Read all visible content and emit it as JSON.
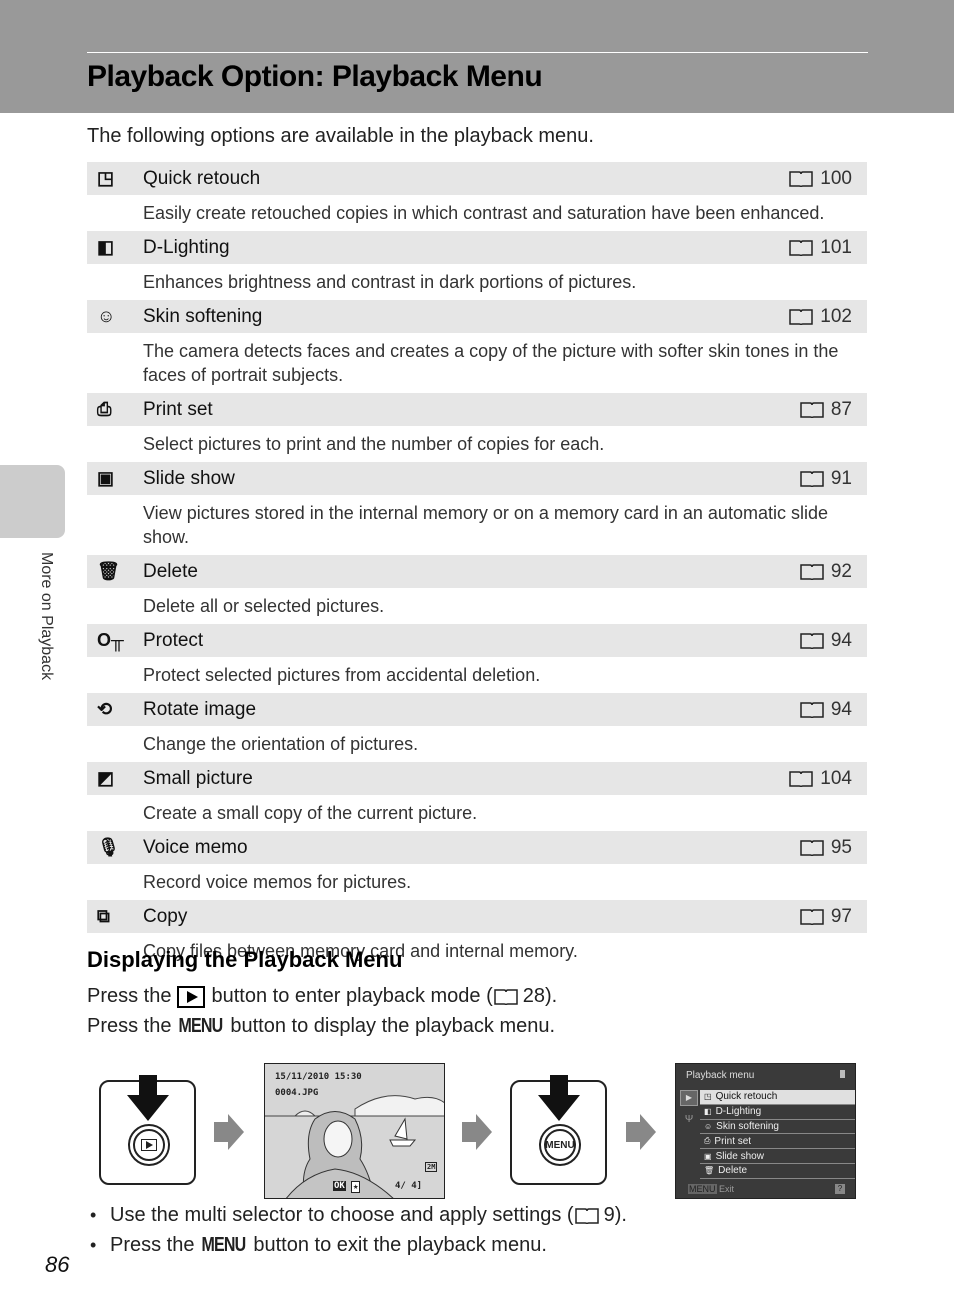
{
  "header": {
    "title": "Playback Option: Playback Menu"
  },
  "intro": "The following options are available in the playback menu.",
  "side_tab": {
    "label": "More on Playback"
  },
  "options": [
    {
      "icon": "quick-retouch",
      "glyph": "◳",
      "label": "Quick retouch",
      "ref": "100",
      "desc": "Easily create retouched copies in which contrast and saturation have been enhanced."
    },
    {
      "icon": "d-lighting",
      "glyph": "◧",
      "label": "D-Lighting",
      "ref": "101",
      "desc": "Enhances brightness and contrast in dark portions of pictures."
    },
    {
      "icon": "skin-softening",
      "glyph": "☺",
      "label": "Skin softening",
      "ref": "102",
      "desc": "The camera detects faces and creates a copy of the picture with softer skin tones in the faces of portrait subjects."
    },
    {
      "icon": "print-set",
      "glyph": "⎙",
      "label": "Print set",
      "ref": "87",
      "desc": "Select pictures to print and the number of copies for each."
    },
    {
      "icon": "slide-show",
      "glyph": "▣",
      "label": "Slide show",
      "ref": "91",
      "desc": "View pictures stored in the internal memory or on a memory card in an automatic slide show."
    },
    {
      "icon": "delete",
      "glyph": "🗑",
      "label": "Delete",
      "ref": "92",
      "desc": "Delete all or selected pictures."
    },
    {
      "icon": "protect",
      "glyph": "O╥",
      "label": "Protect",
      "ref": "94",
      "desc": "Protect selected pictures from accidental deletion."
    },
    {
      "icon": "rotate-image",
      "glyph": "⟲",
      "label": "Rotate image",
      "ref": "94",
      "desc": "Change the orientation of pictures."
    },
    {
      "icon": "small-picture",
      "glyph": "◩",
      "label": "Small picture",
      "ref": "104",
      "desc": "Create a small copy of the current picture."
    },
    {
      "icon": "voice-memo",
      "glyph": "🎙",
      "label": "Voice memo",
      "ref": "95",
      "desc": "Record voice memos for pictures."
    },
    {
      "icon": "copy",
      "glyph": "⧉",
      "label": "Copy",
      "ref": "97",
      "desc": "Copy files between memory card and internal memory."
    }
  ],
  "section": {
    "title": "Displaying the Playback Menu",
    "line1_a": "Press the",
    "line1_b": "button to enter playback mode (",
    "line1_ref": "28",
    "line1_c": ").",
    "line2_a": "Press the",
    "menu_word": "MENU",
    "line2_b": "button to display the playback menu."
  },
  "figure": {
    "playback_button_label": "▶",
    "menu_button_label": "MENU",
    "screen": {
      "datetime": "15/11/2010 15:30",
      "filename": "0004.JPG",
      "counter": "4/    4]",
      "ok_label": "OK"
    },
    "menu_screen": {
      "title": "Playback menu",
      "items": [
        "Quick retouch",
        "D-Lighting",
        "Skin softening",
        "Print set",
        "Slide show",
        "Delete"
      ],
      "selected_index": 0,
      "footer_menu": "MENU",
      "footer_exit": "Exit",
      "help": "?"
    }
  },
  "bullets": [
    {
      "text_a": "Use the multi selector to choose and apply settings (",
      "ref": "9",
      "text_b": ")."
    },
    {
      "text_a": "Press the",
      "menu_word": "MENU",
      "text_b": "button to exit the playback menu."
    }
  ],
  "page_number": "86"
}
